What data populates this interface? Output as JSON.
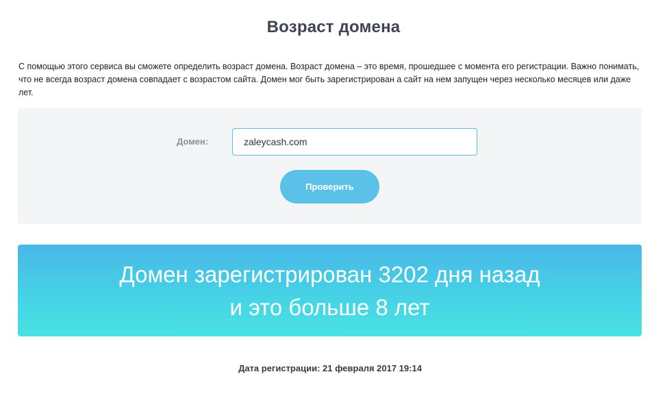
{
  "page": {
    "title": "Возраст домена",
    "description": "С помощью этого сервиса вы сможете определить возраст домена. Возраст домена – это время, прошедшее с момента его регистрации. Важно понимать, что не всегда возраст домена совпадает с возрастом сайта. Домен мог быть зарегистрирован а сайт на нем запущен через несколько месяцев или даже лет."
  },
  "form": {
    "domain_label": "Домен:",
    "domain_value": "zaleycash.com",
    "check_button_label": "Проверить"
  },
  "result": {
    "line1": "Домен зарегистрирован 3202 дня назад",
    "line2": "и это больше 8 лет",
    "registration_date": "Дата регистрации: 21 февраля 2017 19:14"
  },
  "colors": {
    "accent": "#5bc1e9",
    "banner_top": "#48b7e6",
    "banner_bottom": "#49e2e3",
    "panel_bg": "#f3f5f6"
  }
}
